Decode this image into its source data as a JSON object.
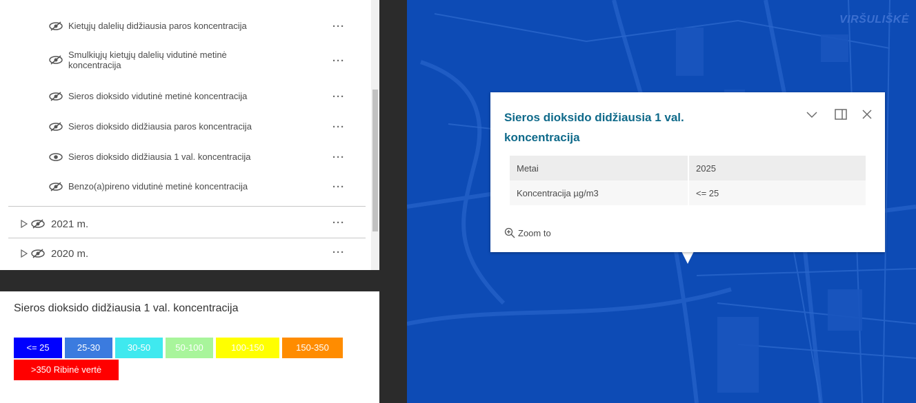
{
  "layers": {
    "sublayers": [
      {
        "label": "Kietųjų dalelių didžiausia paros koncentracija"
      },
      {
        "label": "Smulkiųjų kietųjų dalelių vidutinė metinė koncentracija"
      },
      {
        "label": "Sieros dioksido vidutinė metinė koncentracija"
      },
      {
        "label": "Sieros dioksido didžiausia paros koncentracija"
      },
      {
        "label": "Sieros dioksido didžiausia 1 val. koncentracija"
      },
      {
        "label": "Benzo(a)pireno vidutinė metinė koncentracija"
      }
    ],
    "groups": [
      {
        "label": "2021 m."
      },
      {
        "label": "2020 m."
      }
    ],
    "more_label": "···"
  },
  "legend": {
    "title": "Sieros dioksido didžiausia 1 val. koncentracija",
    "classes": [
      {
        "label": "<= 25",
        "color": "#0000ff"
      },
      {
        "label": "25-30",
        "color": "#3b7bdf"
      },
      {
        "label": "30-50",
        "color": "#3fe9ef"
      },
      {
        "label": "50-100",
        "color": "#a8f59b"
      },
      {
        "label": "100-150",
        "color": "#ffff00"
      },
      {
        "label": "150-350",
        "color": "#ff8c00"
      },
      {
        "label": ">350 Ribinė vertė",
        "color": "#ff0000"
      }
    ]
  },
  "map": {
    "place_label": "VIRŠULIŠKĖ",
    "background_color": "#0d4bb5"
  },
  "popup": {
    "title": "Sieros dioksido didžiausia 1 val. koncentracija",
    "fields": [
      {
        "key": "Metai",
        "value": "2025"
      },
      {
        "key": "Koncentracija µg/m3",
        "value": "<= 25"
      }
    ],
    "zoom_label": "Zoom to",
    "accent_color": "#0f6a8a"
  }
}
